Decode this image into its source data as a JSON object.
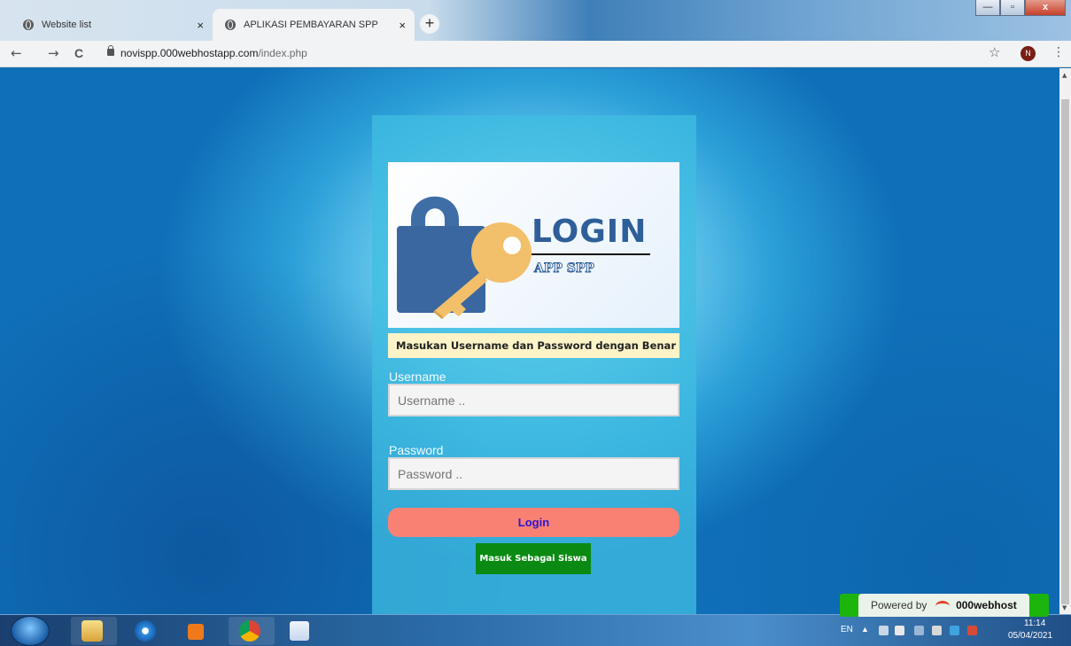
{
  "browser": {
    "tabs": [
      {
        "label": "Website list",
        "close": "×"
      },
      {
        "label": "APLIKASI PEMBAYARAN SPP",
        "close": "×"
      }
    ],
    "new_tab": "+",
    "window_buttons": {
      "minimize": "—",
      "maximize": "▫",
      "close": "x"
    },
    "nav": {
      "back": "←",
      "forward": "→",
      "reload": "C"
    },
    "url_host": "novispp.000webhostapp.com",
    "url_path": "/index.php",
    "bookmark_icon": "☆",
    "profile_initial": "N",
    "menu_icon": "⋮"
  },
  "login": {
    "logo": {
      "title": "LOGIN",
      "subtitle": "APP SPP"
    },
    "alert": "Masukan Username dan Password dengan Benar !!!",
    "username_label": "Username",
    "username_placeholder": "Username ..",
    "password_label": "Password",
    "password_placeholder": "Password ..",
    "login_button": "Login",
    "siswa_button": "Masuk Sebagai Siswa"
  },
  "footer_badge": {
    "prefix": "Powered by",
    "brand": "000webhost"
  },
  "taskbar": {
    "lang": "EN",
    "time": "11:14",
    "date": "05/04/2021"
  },
  "colors": {
    "card": "#40bee1",
    "login_button": "#f98173",
    "login_text": "#2a14d6",
    "siswa_button": "#0a8a12",
    "alert_bg": "#fdf3c7"
  }
}
